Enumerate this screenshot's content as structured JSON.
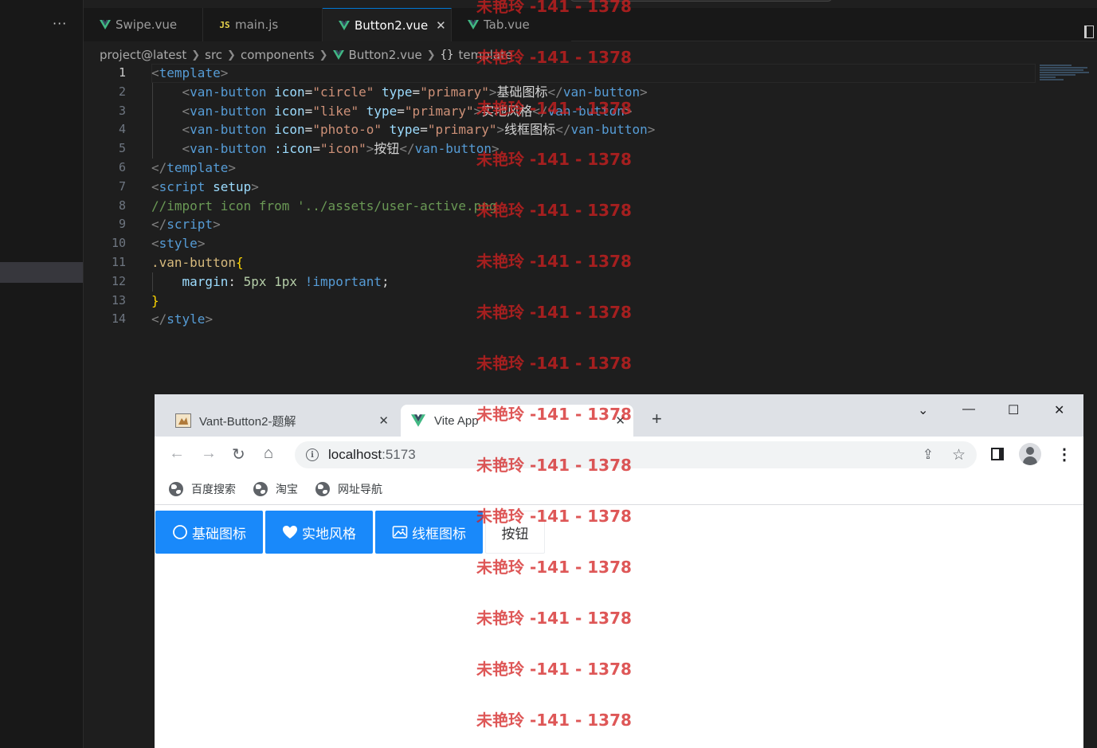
{
  "editor": {
    "tabs": [
      {
        "label": "Swipe.vue",
        "icon": "vue-icon",
        "active": false
      },
      {
        "label": "main.js",
        "icon": "js-icon",
        "active": false
      },
      {
        "label": "Button2.vue",
        "icon": "vue-icon",
        "active": true
      },
      {
        "label": "Tab.vue",
        "icon": "vue-icon",
        "active": false
      }
    ],
    "sidebar_more": "···",
    "tab_close": "✕",
    "js_badge": "JS",
    "breadcrumb": [
      "project@latest",
      "src",
      "components",
      "Button2.vue",
      "template"
    ],
    "breadcrumb_curly": "{}",
    "line_numbers": [
      "1",
      "2",
      "3",
      "4",
      "5",
      "6",
      "7",
      "8",
      "9",
      "10",
      "11",
      "12",
      "13",
      "14"
    ],
    "code": {
      "l1": {
        "a": "<",
        "b": "template",
        "c": ">"
      },
      "l2": {
        "indent": "    ",
        "o": "<",
        "tag": "van-button",
        "a1": "icon",
        "eq1": "=",
        "v1": "\"circle\"",
        "a2": "type",
        "eq2": "=",
        "v2": "\"primary\"",
        "gt": ">",
        "text": "基础图标",
        "close": "</",
        "ctag": "van-button",
        "cgt": ">"
      },
      "l3": {
        "indent": "    ",
        "o": "<",
        "tag": "van-button",
        "a1": "icon",
        "eq1": "=",
        "v1": "\"like\"",
        "a2": "type",
        "eq2": "=",
        "v2": "\"primary\"",
        "gt": ">",
        "text": "实地风格",
        "close": "</",
        "ctag": "van-button",
        "cgt": ">"
      },
      "l4": {
        "indent": "    ",
        "o": "<",
        "tag": "van-button",
        "a1": "icon",
        "eq1": "=",
        "v1": "\"photo-o\"",
        "a2": "type",
        "eq2": "=",
        "v2": "\"primary\"",
        "gt": ">",
        "text": "线框图标",
        "close": "</",
        "ctag": "van-button",
        "cgt": ">"
      },
      "l5": {
        "indent": "    ",
        "o": "<",
        "tag": "van-button",
        "a1": ":icon",
        "eq1": "=",
        "v1": "\"icon\"",
        "gt": ">",
        "text": "按钮",
        "close": "</",
        "ctag": "van-button",
        "cgt": ">"
      },
      "l6": {
        "a": "</",
        "b": "template",
        "c": ">"
      },
      "l7": {
        "a": "<",
        "b": "script",
        "attr": "setup",
        "c": ">"
      },
      "l8": {
        "comment": "//import icon from '../assets/user-active.png"
      },
      "l9": {
        "a": "</",
        "b": "script",
        "c": ">"
      },
      "l10": {
        "a": "<",
        "b": "style",
        "c": ">"
      },
      "l11": {
        "sel": ".van-button",
        "brace": "{"
      },
      "l12": {
        "indent": "    ",
        "prop": "margin",
        "colon": ": ",
        "v1": "5px",
        "v2": "1px",
        "imp": "!important",
        "semi": ";"
      },
      "l13": {
        "brace": "}"
      },
      "l14": {
        "a": "</",
        "b": "style",
        "c": ">"
      }
    }
  },
  "browser": {
    "tabs": [
      {
        "title": "Vant-Button2-题解",
        "icon": "page-favicon"
      },
      {
        "title": "Vite App",
        "icon": "vite-favicon"
      }
    ],
    "tab_close": "✕",
    "new_tab": "+",
    "window_controls": {
      "list": "⌄",
      "minimize": "—",
      "maximize": "☐",
      "close": "✕"
    },
    "nav": {
      "back": "←",
      "forward": "→",
      "reload": "↻",
      "home": "⌂"
    },
    "url_host": "localhost",
    "url_port": ":5173",
    "info_icon": "i",
    "share_icon": "⇪",
    "star_icon": "☆",
    "menu_icon": "⋮",
    "bookmarks": [
      "百度搜索",
      "淘宝",
      "网址导航"
    ],
    "buttons": [
      {
        "label": "基础图标",
        "icon": "circle-icon",
        "type": "primary"
      },
      {
        "label": "实地风格",
        "icon": "heart-icon",
        "type": "primary"
      },
      {
        "label": "线框图标",
        "icon": "photo-icon",
        "type": "primary"
      },
      {
        "label": "按钮",
        "icon": "",
        "type": "default"
      }
    ],
    "colors": {
      "primary": "#1989fa"
    }
  },
  "watermark": "未艳玲 -141 - 1378"
}
